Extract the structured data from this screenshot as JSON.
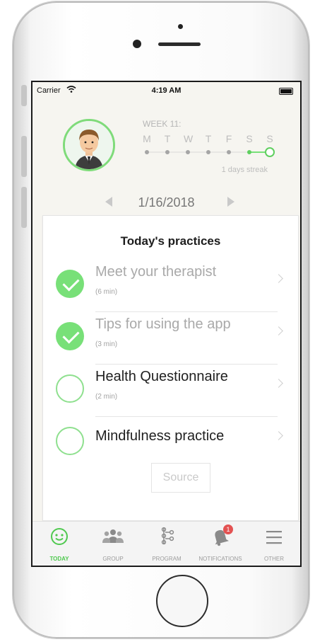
{
  "status_bar": {
    "carrier": "Carrier",
    "time": "4:19 AM"
  },
  "week": {
    "label": "WEEK 11:",
    "days": [
      "M",
      "T",
      "W",
      "T",
      "F",
      "S",
      "S"
    ],
    "streak": "1 days streak"
  },
  "date_nav": {
    "date": "1/16/2018"
  },
  "practices": {
    "title": "Today's practices",
    "items": [
      {
        "title": "Meet your therapist",
        "duration": "(6 min)",
        "status": "completed"
      },
      {
        "title": "Tips for using the app",
        "duration": "(3 min)",
        "status": "completed"
      },
      {
        "title": "Health Questionnaire",
        "duration": "(2 min)",
        "status": "pending"
      },
      {
        "title": "Mindfulness practice",
        "duration": "",
        "status": "pending"
      }
    ],
    "source_label": "Source"
  },
  "tabbar": {
    "tabs": [
      {
        "label": "TODAY",
        "icon": "smiley-icon",
        "active": true
      },
      {
        "label": "GROUP",
        "icon": "group-icon",
        "active": false
      },
      {
        "label": "PROGRAM",
        "icon": "program-icon",
        "active": false
      },
      {
        "label": "NOTIFICATIONS",
        "icon": "bell-icon",
        "active": false,
        "badge": "1"
      },
      {
        "label": "OTHER",
        "icon": "menu-icon",
        "active": false
      }
    ]
  },
  "colors": {
    "accent_green": "#78e078",
    "badge_red": "#e35252"
  }
}
